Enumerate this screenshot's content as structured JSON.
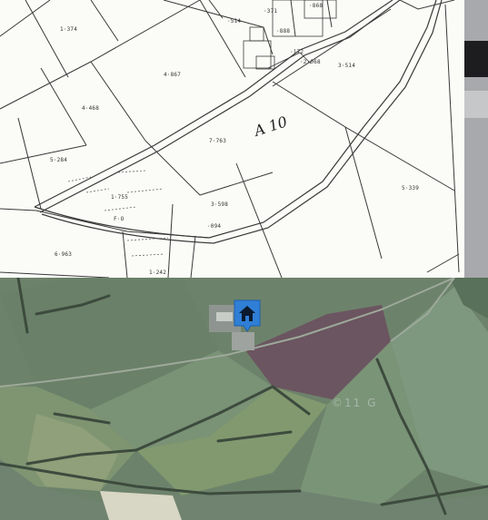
{
  "os_map": {
    "parcel_labels": [
      {
        "text": "1·374"
      },
      {
        "text": "·514"
      },
      {
        "text": "·371"
      },
      {
        "text": "·868"
      },
      {
        "text": "·888"
      },
      {
        "text": "·172"
      },
      {
        "text": "·2·068"
      },
      {
        "text": "3·514"
      },
      {
        "text": "4·867"
      },
      {
        "text": "4·468"
      },
      {
        "text": "5·284"
      },
      {
        "text": "7·763"
      },
      {
        "text": "3·598"
      },
      {
        "text": "5·339"
      },
      {
        "text": "1·755"
      },
      {
        "text": "6·963"
      },
      {
        "text": "1·242"
      },
      {
        "text": "·094"
      },
      {
        "text": "F·O"
      }
    ],
    "annotation": "A 10",
    "colors": {
      "paper": "#fbfbf8",
      "ink": "#3a3a3a"
    }
  },
  "satellite": {
    "watermark": "©11 G",
    "colors": {
      "field": "#6d826b",
      "bog": "#6b5560",
      "trees": "#3d4b3e"
    }
  },
  "marker": {
    "icon": "home-icon",
    "color": "#2f7fd6"
  }
}
